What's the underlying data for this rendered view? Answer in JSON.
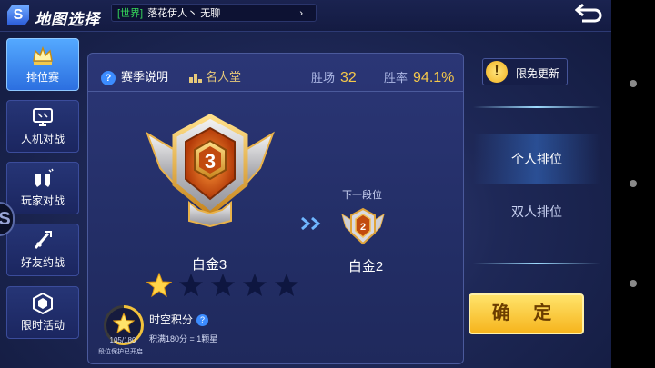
{
  "header": {
    "logo": "S",
    "title": "地图选择",
    "chat": {
      "channel": "[世界]",
      "message": "落花伊人丶 无聊",
      "arrow": "›"
    }
  },
  "sidebar": {
    "items": [
      {
        "label": "排位赛",
        "icon": "crown-icon",
        "active": true
      },
      {
        "label": "人机对战",
        "icon": "monitor-icon",
        "active": false
      },
      {
        "label": "玩家对战",
        "icon": "fists-icon",
        "active": false
      },
      {
        "label": "好友约战",
        "icon": "swords-icon",
        "active": false
      },
      {
        "label": "限时活动",
        "icon": "hexagon-badge-icon",
        "active": false
      }
    ],
    "edge_logo": "S"
  },
  "panel": {
    "season_info": "赛季说明",
    "hall_of_fame": "名人堂",
    "wins_label": "胜场",
    "wins_value": "32",
    "winrate_label": "胜率",
    "winrate_value": "94.1%",
    "current_rank": {
      "tier_number": "3",
      "name": "白金3",
      "stars_filled": 1,
      "stars_total": 5
    },
    "next_rank": {
      "label": "下一段位",
      "tier_number": "2",
      "name": "白金2"
    },
    "points": {
      "title": "时空积分",
      "rule": "积满180分 = 1颗星",
      "count": "105/180",
      "protection": "段位保护已开启",
      "progress": 0.583
    }
  },
  "right": {
    "free_update": "限免更新",
    "tabs": [
      {
        "label": "个人排位",
        "active": true
      },
      {
        "label": "双人排位",
        "active": false
      }
    ],
    "confirm": "确 定"
  },
  "colors": {
    "accent_gold": "#f5c84a",
    "active_blue": "#3c8cff",
    "confirm_yellow": "#f6b51e"
  }
}
